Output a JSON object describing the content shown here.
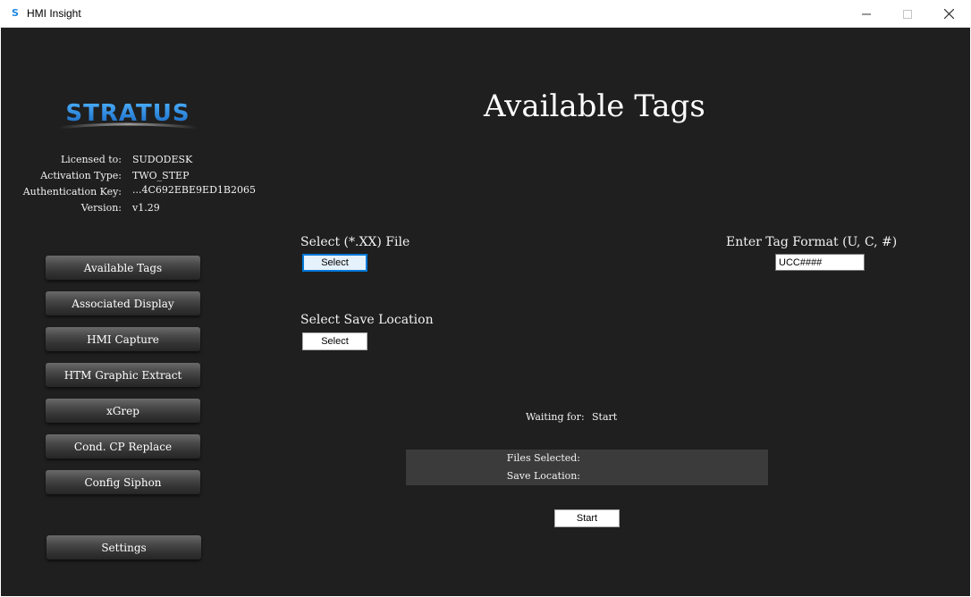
{
  "window": {
    "title": "HMI Insight",
    "icon": "stratus-app-icon"
  },
  "branding": {
    "logo_text": "STRATUS",
    "logo_color": "#1e88e5"
  },
  "license": {
    "licensed_to_label": "Licensed to:",
    "licensed_to_value": "SUDODESK",
    "activation_type_label": "Activation Type:",
    "activation_type_value": "TWO_STEP",
    "auth_key_label": "Authentication Key:",
    "auth_key_value": "...4C692EBE9ED1B2065",
    "version_label": "Version:",
    "version_value": "v1.29"
  },
  "nav": {
    "items": [
      {
        "label": "Available Tags"
      },
      {
        "label": "Associated Display"
      },
      {
        "label": "HMI Capture"
      },
      {
        "label": "HTM Graphic Extract"
      },
      {
        "label": "xGrep"
      },
      {
        "label": "Cond. CP Replace"
      },
      {
        "label": "Config Siphon"
      }
    ],
    "settings_label": "Settings"
  },
  "main": {
    "title": "Available Tags",
    "select_file_label": "Select (*.XX) File",
    "select_file_button": "Select",
    "select_save_label": "Select Save Location",
    "select_save_button": "Select",
    "tag_format_label": "Enter Tag Format (U, C, #)",
    "tag_format_value": "UCC####",
    "waiting_label": "Waiting for:",
    "waiting_value": "Start",
    "files_selected_label": "Files Selected:",
    "save_location_label": "Save Location:",
    "start_button": "Start"
  }
}
